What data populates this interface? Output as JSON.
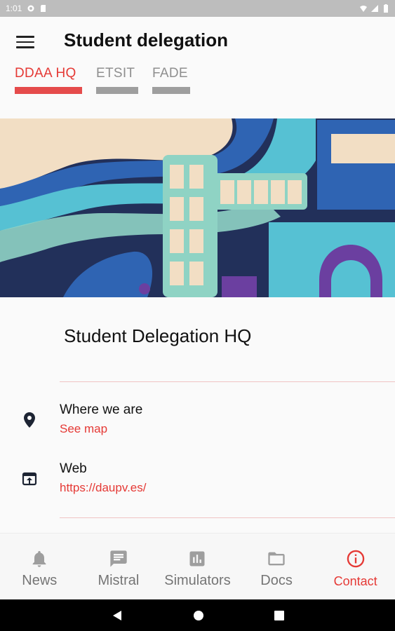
{
  "status_bar": {
    "time": "1:01"
  },
  "header": {
    "title": "Student delegation",
    "tabs": [
      {
        "label": "DDAA HQ",
        "active": true
      },
      {
        "label": "ETSIT",
        "active": false
      },
      {
        "label": "FADE",
        "active": false
      }
    ]
  },
  "place": {
    "name": "Student Delegation HQ",
    "location": {
      "title": "Where we are",
      "link": "See map"
    },
    "web": {
      "title": "Web",
      "link": "https://daupv.es/"
    }
  },
  "bottom_nav": {
    "items": [
      {
        "label": "News",
        "icon": "bell-icon"
      },
      {
        "label": "Mistral",
        "icon": "chat-icon"
      },
      {
        "label": "Simulators",
        "icon": "bar-chart-icon"
      },
      {
        "label": "Docs",
        "icon": "folder-icon"
      },
      {
        "label": "Contact",
        "icon": "info-icon",
        "active": true
      }
    ]
  },
  "colors": {
    "accent": "#e53935",
    "inactive": "#9e9e9e"
  }
}
